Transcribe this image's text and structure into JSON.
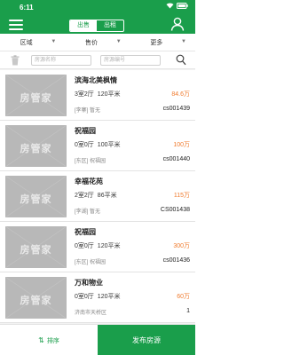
{
  "status": {
    "time": "6:11"
  },
  "header": {
    "tabs": [
      {
        "label": "出售",
        "active": true
      },
      {
        "label": "出租",
        "active": false
      }
    ]
  },
  "filters": [
    {
      "label": "区域"
    },
    {
      "label": "售价"
    },
    {
      "label": "更多"
    }
  ],
  "search": {
    "name_placeholder": "房源名称",
    "code_placeholder": "房源编号"
  },
  "listings": [
    {
      "title": "滨海北美枫情",
      "layout": "3室2厅",
      "area": "120平米",
      "price": "84.6万",
      "meta": "[李寨]   暂无",
      "code": "cs001439"
    },
    {
      "title": "祝福园",
      "layout": "0室0厅",
      "area": "100平米",
      "price": "100万",
      "meta": "[东区]   祝福园",
      "code": "cs001440"
    },
    {
      "title": "幸福花苑",
      "layout": "2室2厅",
      "area": "86平米",
      "price": "115万",
      "meta": "[李湖]   暂无",
      "code": "CS001438"
    },
    {
      "title": "祝福园",
      "layout": "0室0厅",
      "area": "120平米",
      "price": "300万",
      "meta": "[东区]   祝福园",
      "code": "cs001436"
    },
    {
      "title": "万和物业",
      "layout": "0室0厅",
      "area": "120平米",
      "price": "60万",
      "meta": "济南市天桥区",
      "code": "1"
    }
  ],
  "thumb_text": "房管家",
  "bottom": {
    "sort_label": "排序",
    "publish_label": "发布房源"
  },
  "colors": {
    "brand_green": "#1a9e4b",
    "price_orange": "#f07b2e"
  }
}
